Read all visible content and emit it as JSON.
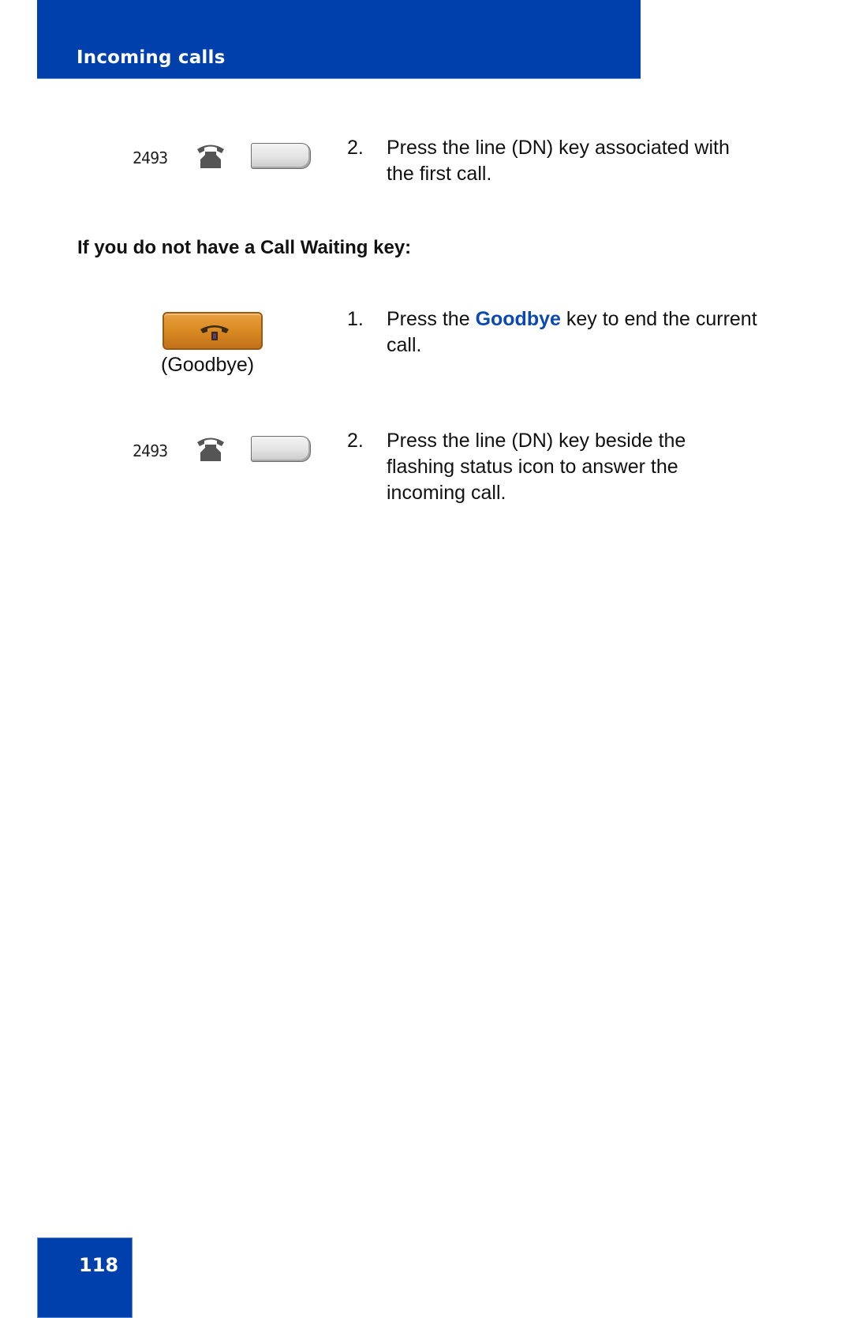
{
  "header": {
    "title": "Incoming calls",
    "band_color": "#0040ad"
  },
  "page": {
    "number": "118"
  },
  "section_a": {
    "line_key": {
      "dn": "2493",
      "icon": "phone-handset-icon"
    },
    "step": {
      "number": "2.",
      "text": "Press the line (DN) key associated with the first call."
    }
  },
  "section_b": {
    "heading": "If you do not have a Call Waiting key:",
    "steps": [
      {
        "number": "1.",
        "text_before": "Press the ",
        "highlight": "Goodbye",
        "text_after": " key to end the current call.",
        "key_caption": "(Goodbye)",
        "highlight_color": "#0a48b4"
      },
      {
        "number": "2.",
        "text": "Press the line (DN) key beside the flashing status icon to answer the incoming call.",
        "line_key": {
          "dn": "2493",
          "icon": "phone-handset-icon"
        }
      }
    ]
  }
}
